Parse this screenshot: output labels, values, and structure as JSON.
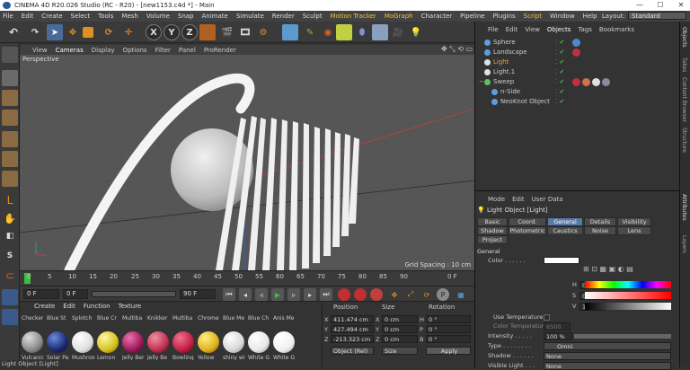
{
  "window": {
    "title": "CINEMA 4D R20.026 Studio (RC - R20) - [new1153.c4d *] - Main",
    "min": "—",
    "max": "☐",
    "close": "✕"
  },
  "menu": [
    "File",
    "Edit",
    "Create",
    "Select",
    "Tools",
    "Mesh",
    "Volume",
    "Snap",
    "Animate",
    "Simulate",
    "Render",
    "Sculpt",
    "Motion Tracker",
    "MoGraph",
    "Character",
    "Pipeline",
    "Plugins",
    "Script",
    "Window",
    "Help"
  ],
  "layout": {
    "label": "Layout:",
    "value": "Standard"
  },
  "toolbar": {
    "undo": "↶",
    "x": "X",
    "y": "Y",
    "z": "Z"
  },
  "viewport": {
    "menu": [
      "View",
      "Cameras",
      "Display",
      "Options",
      "Filter",
      "Panel",
      "ProRender"
    ],
    "label": "Perspective",
    "grid_spacing": "Grid Spacing : 10 cm"
  },
  "timeline": {
    "ticks": [
      "0",
      "5",
      "10",
      "15",
      "20",
      "25",
      "30",
      "35",
      "40",
      "45",
      "50",
      "55",
      "60",
      "65",
      "70",
      "75",
      "80",
      "85",
      "90"
    ],
    "end": "0 F"
  },
  "playback": {
    "current": "0 F",
    "start": "0 F",
    "end_a": "90 F",
    "end_b": "90 F"
  },
  "materials": {
    "menu": [
      "Create",
      "Edit",
      "Function",
      "Texture"
    ],
    "items": [
      {
        "name": "Checker",
        "name2": "Vulcanic",
        "color": "#8a8a8a"
      },
      {
        "name": "Blue St",
        "name2": "Solar Pa",
        "color": "#1a2a70"
      },
      {
        "name": "Splotch",
        "name2": "Mushroo",
        "color": "#e0e0e0"
      },
      {
        "name": "Blue Cr",
        "name2": "Lemon",
        "color": "#d6c020"
      },
      {
        "name": "Multiba",
        "name2": "Jelly Ber",
        "color": "#9a1a5a"
      },
      {
        "name": "Knikker",
        "name2": "Jelly Be",
        "color": "#c03050"
      },
      {
        "name": "Multiba",
        "name2": "Bowling",
        "color": "#c02040"
      },
      {
        "name": "Chrome",
        "name2": "Yellow",
        "color": "#e0b020"
      },
      {
        "name": "Blue Me",
        "name2": "shiny wi",
        "color": "#d8d8d8"
      },
      {
        "name": "Blue Ch",
        "name2": "White G",
        "color": "#e8e8e8"
      },
      {
        "name": "Anis Me",
        "name2": "White G",
        "color": "#f0f0f0"
      }
    ]
  },
  "coords": {
    "headers": [
      "Position",
      "Size",
      "Rotation"
    ],
    "rows": [
      {
        "axis": "X",
        "pos": "411.474 cm",
        "saxis": "X",
        "size": "0 cm",
        "raxis": "H",
        "rot": "0 °"
      },
      {
        "axis": "Y",
        "pos": "427.494 cm",
        "saxis": "Y",
        "size": "0 cm",
        "raxis": "P",
        "rot": "0 °"
      },
      {
        "axis": "Z",
        "pos": "-213.323 cm",
        "saxis": "Z",
        "size": "0 cm",
        "raxis": "B",
        "rot": "0 °"
      }
    ],
    "mode": "Object (Rel)",
    "size_mode": "Size",
    "apply": "Apply"
  },
  "objects_panel": {
    "menu": [
      "File",
      "Edit",
      "View",
      "Objects",
      "Tags",
      "Bookmarks"
    ],
    "items": [
      {
        "name": "Sphere",
        "color": "#ccc",
        "icon": "#5aa0e0"
      },
      {
        "name": "Landscape",
        "color": "#ccc",
        "icon": "#5aa0e0"
      },
      {
        "name": "Light",
        "color": "#f0a040",
        "icon": "#e0e0e0"
      },
      {
        "name": "Light.1",
        "color": "#ccc",
        "icon": "#e0e0e0"
      },
      {
        "name": "Sweep",
        "color": "#ccc",
        "icon": "#60c060"
      },
      {
        "name": "n-Side",
        "color": "#ccc",
        "icon": "#5aa0e0"
      },
      {
        "name": "NeoKnot Object",
        "color": "#ccc",
        "icon": "#5aa0e0"
      }
    ]
  },
  "attributes": {
    "menu": [
      "Mode",
      "Edit",
      "User Data"
    ],
    "header": "Light Object [Light]",
    "tabs": [
      "Basic",
      "Coord.",
      "General",
      "Details",
      "Visibility",
      "Shadow",
      "Photometric",
      "Caustics",
      "Noise",
      "Lens",
      "Project"
    ],
    "section": "General",
    "color_label": "Color . . . . . .",
    "hsv": [
      {
        "k": "H",
        "v": "0 °"
      },
      {
        "k": "S",
        "v": "0 %"
      },
      {
        "k": "V",
        "v": "100 %"
      }
    ],
    "use_temp": "Use Temperature",
    "color_temp": "Color Temperature",
    "color_temp_value": "6500",
    "intensity_label": "Intensity . . . . .",
    "intensity_value": "100 %",
    "type_label": "Type . . . . . . . .",
    "type_value": "Omni",
    "shadow_label": "Shadow . . . . . .",
    "shadow_value": "None",
    "visible_label": "Visible Light . . .",
    "visible_value": "None"
  },
  "side_tabs": [
    "Objects",
    "Takes",
    "Content Browser",
    "Structure",
    "Attributes",
    "Layers"
  ],
  "status": "Light Object [Light]"
}
